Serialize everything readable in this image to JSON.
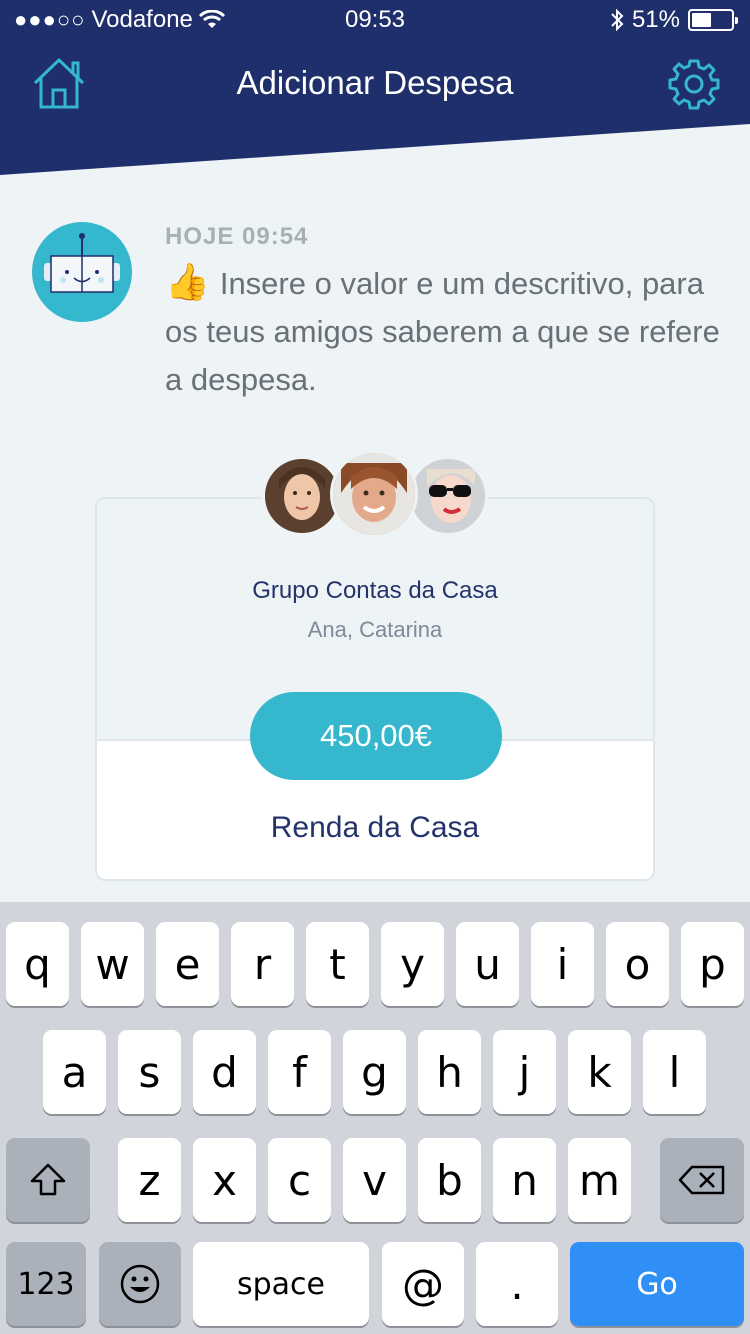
{
  "status_bar": {
    "signal": "●●●○○",
    "carrier": "Vodafone",
    "time": "09:53",
    "battery": "51%",
    "battery_level": 0.51
  },
  "header": {
    "title": "Adicionar Despesa",
    "home_icon": "home-icon",
    "settings_icon": "gear-icon",
    "bg_color": "#1f2f6b"
  },
  "message": {
    "timestamp": "HOJE 09:54",
    "emoji": "👍",
    "text": "Insere o valor e um descritivo, para os teus amigos saberem a que se refere a despesa."
  },
  "card": {
    "group_name": "Grupo Contas da Casa",
    "members": "Ana, Catarina",
    "amount": "450,00€",
    "description": "Renda da Casa",
    "accent_color": "#35b7cd"
  },
  "keyboard": {
    "row1": [
      "q",
      "w",
      "e",
      "r",
      "t",
      "y",
      "u",
      "i",
      "o",
      "p"
    ],
    "row2": [
      "a",
      "s",
      "d",
      "f",
      "g",
      "h",
      "j",
      "k",
      "l"
    ],
    "row3": [
      "z",
      "x",
      "c",
      "v",
      "b",
      "n",
      "m"
    ],
    "numbers_key": "123",
    "space_key": "space",
    "at_key": "@",
    "dot_key": ".",
    "go_key": "Go"
  }
}
